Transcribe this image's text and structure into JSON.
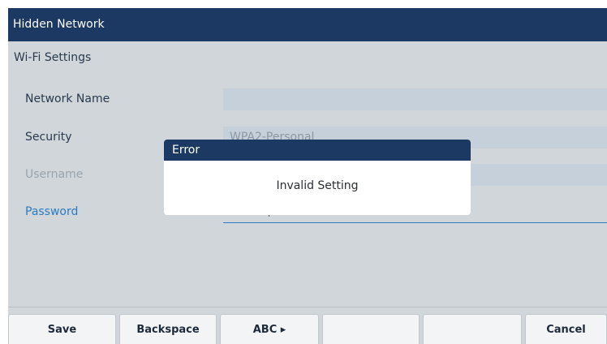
{
  "window": {
    "title": "Hidden Network"
  },
  "section": {
    "title": "Wi-Fi Settings"
  },
  "form": {
    "network_name": {
      "label": "Network Name",
      "value": ""
    },
    "security": {
      "label": "Security",
      "value": "WPA2-Personal"
    },
    "username": {
      "label": "Username",
      "value": ""
    },
    "password": {
      "label": "Password",
      "value": ""
    }
  },
  "dialog": {
    "title": "Error",
    "message": "Invalid Setting"
  },
  "softkeys": [
    "Save",
    "Backspace",
    "ABC ▸",
    "",
    "",
    "Cancel"
  ],
  "colors": {
    "header": "#1c3963",
    "accent": "#2e7bbf",
    "background": "#d0d6da"
  }
}
